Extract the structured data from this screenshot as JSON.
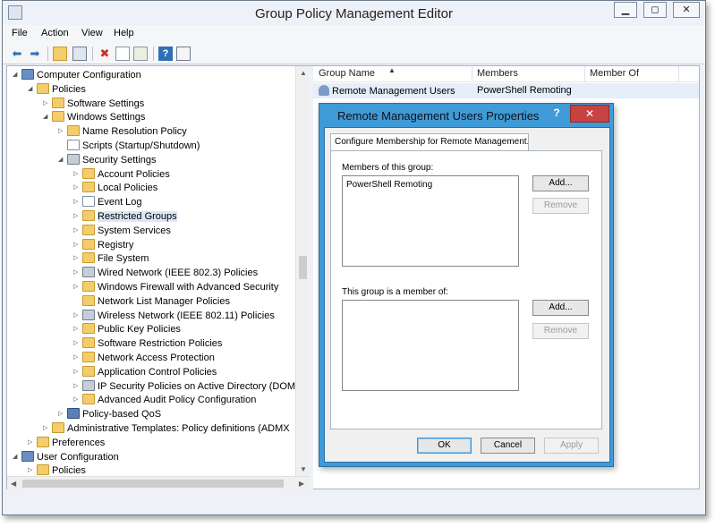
{
  "window": {
    "title": "Group Policy Management Editor",
    "minimize": "▁",
    "maximize": "◻",
    "close": "✕"
  },
  "menu": [
    "File",
    "Action",
    "View",
    "Help"
  ],
  "toolbar_icons": [
    "back-icon",
    "forward-icon",
    "up-folder-icon",
    "show-hide-tree-icon",
    "delete-icon",
    "properties-icon",
    "export-icon",
    "help-icon",
    "show-pane-icon"
  ],
  "tree": [
    {
      "label": "Computer Configuration",
      "indent": 0,
      "icon": "computer-icon",
      "expander": "◢"
    },
    {
      "label": "Policies",
      "indent": 1,
      "icon": "folder-icon",
      "expander": "◢"
    },
    {
      "label": "Software Settings",
      "indent": 2,
      "icon": "folder-icon",
      "expander": "▷"
    },
    {
      "label": "Windows Settings",
      "indent": 2,
      "icon": "folder-icon",
      "expander": "◢"
    },
    {
      "label": "Name Resolution Policy",
      "indent": 3,
      "icon": "folder-icon",
      "expander": "▷"
    },
    {
      "label": "Scripts (Startup/Shutdown)",
      "indent": 3,
      "icon": "script-icon",
      "expander": ""
    },
    {
      "label": "Security Settings",
      "indent": 3,
      "icon": "security-icon",
      "expander": "◢"
    },
    {
      "label": "Account Policies",
      "indent": 4,
      "icon": "folder-icon",
      "expander": "▷"
    },
    {
      "label": "Local Policies",
      "indent": 4,
      "icon": "folder-icon",
      "expander": "▷"
    },
    {
      "label": "Event Log",
      "indent": 4,
      "icon": "log-icon",
      "expander": "▷"
    },
    {
      "label": "Restricted Groups",
      "indent": 4,
      "icon": "folder-icon",
      "expander": "▷"
    },
    {
      "label": "System Services",
      "indent": 4,
      "icon": "folder-icon",
      "expander": "▷"
    },
    {
      "label": "Registry",
      "indent": 4,
      "icon": "folder-icon",
      "expander": "▷"
    },
    {
      "label": "File System",
      "indent": 4,
      "icon": "folder-icon",
      "expander": "▷"
    },
    {
      "label": "Wired Network (IEEE 802.3) Policies",
      "indent": 4,
      "icon": "network-icon",
      "expander": "▷"
    },
    {
      "label": "Windows Firewall with Advanced Security",
      "indent": 4,
      "icon": "folder-icon",
      "expander": "▷"
    },
    {
      "label": "Network List Manager Policies",
      "indent": 4,
      "icon": "folder-icon",
      "expander": ""
    },
    {
      "label": "Wireless Network (IEEE 802.11) Policies",
      "indent": 4,
      "icon": "wireless-icon",
      "expander": "▷"
    },
    {
      "label": "Public Key Policies",
      "indent": 4,
      "icon": "folder-icon",
      "expander": "▷"
    },
    {
      "label": "Software Restriction Policies",
      "indent": 4,
      "icon": "folder-icon",
      "expander": "▷"
    },
    {
      "label": "Network Access Protection",
      "indent": 4,
      "icon": "folder-icon",
      "expander": "▷"
    },
    {
      "label": "Application Control Policies",
      "indent": 4,
      "icon": "folder-icon",
      "expander": "▷"
    },
    {
      "label": "IP Security Policies on Active Directory (DOMA",
      "indent": 4,
      "icon": "ipsec-icon",
      "expander": "▷"
    },
    {
      "label": "Advanced Audit Policy Configuration",
      "indent": 4,
      "icon": "folder-icon",
      "expander": "▷"
    },
    {
      "label": "Policy-based QoS",
      "indent": 3,
      "icon": "chart-icon",
      "expander": "▷"
    },
    {
      "label": "Administrative Templates: Policy definitions (ADMX",
      "indent": 2,
      "icon": "folder-icon",
      "expander": "▷"
    },
    {
      "label": "Preferences",
      "indent": 1,
      "icon": "folder-icon",
      "expander": "▷"
    },
    {
      "label": "User Configuration",
      "indent": 0,
      "icon": "user-icon",
      "expander": "◢"
    },
    {
      "label": "Policies",
      "indent": 1,
      "icon": "folder-icon",
      "expander": "▷"
    }
  ],
  "selected_tree_index": 10,
  "list": {
    "columns": [
      "Group Name",
      "Members",
      "Member Of"
    ],
    "sort_glyph": "▲",
    "rows": [
      {
        "group": "Remote Management Users",
        "members": "PowerShell Remoting",
        "member_of": ""
      }
    ]
  },
  "dialog": {
    "title": "Remote Management Users Properties",
    "help": "?",
    "close": "✕",
    "tab": "Configure Membership for Remote Management...",
    "members_label": "Members of this group:",
    "members": [
      "PowerShell Remoting"
    ],
    "memberof_label": "This group is a member of:",
    "memberof": [],
    "add1": "Add...",
    "remove1": "Remove",
    "add2": "Add...",
    "remove2": "Remove",
    "ok": "OK",
    "cancel": "Cancel",
    "apply": "Apply"
  },
  "scroll_glyphs": {
    "up": "▲",
    "down": "▼",
    "left": "◀",
    "right": "▶"
  }
}
